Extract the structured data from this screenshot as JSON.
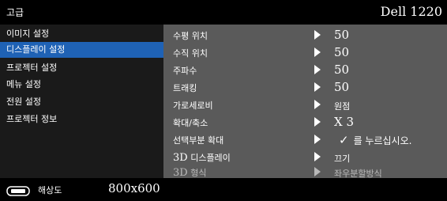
{
  "title": {
    "left": "고급",
    "right": "Dell 1220"
  },
  "sidebar": {
    "items": [
      {
        "label": "이미지 설정"
      },
      {
        "label": "디스플레이 설정"
      },
      {
        "label": "프로젝터 설정"
      },
      {
        "label": "메뉴 설정"
      },
      {
        "label": "전원 설정"
      },
      {
        "label": "프로젝터 정보"
      }
    ],
    "active_index": 1
  },
  "rows": [
    {
      "label": "수평 위치",
      "value": "50"
    },
    {
      "label": "수직 위치",
      "value": "50"
    },
    {
      "label": "주파수",
      "value": "50"
    },
    {
      "label": "트래킹",
      "value": "50"
    },
    {
      "label": "가로세로비",
      "value": "원점"
    },
    {
      "label": "확대/축소",
      "value": "X 3"
    },
    {
      "label": "선택부분 확대",
      "value_check": "✓",
      "value": "를 누르십시오."
    },
    {
      "label": "3D 디스플레이",
      "value": "끄기"
    },
    {
      "label": "3D 형식",
      "value": "좌우분할방식",
      "disabled": true
    }
  ],
  "footer": {
    "resolution_label": "해상도",
    "resolution_value": "800x600"
  },
  "colors": {
    "active": "#1f62b5",
    "panel": "#5a5a5a",
    "sidebar": "#1a1a1a"
  },
  "icons": {
    "arrow": "right-triangle-icon",
    "resolution": "monitor-resolution-icon",
    "check": "check-mark-icon"
  }
}
